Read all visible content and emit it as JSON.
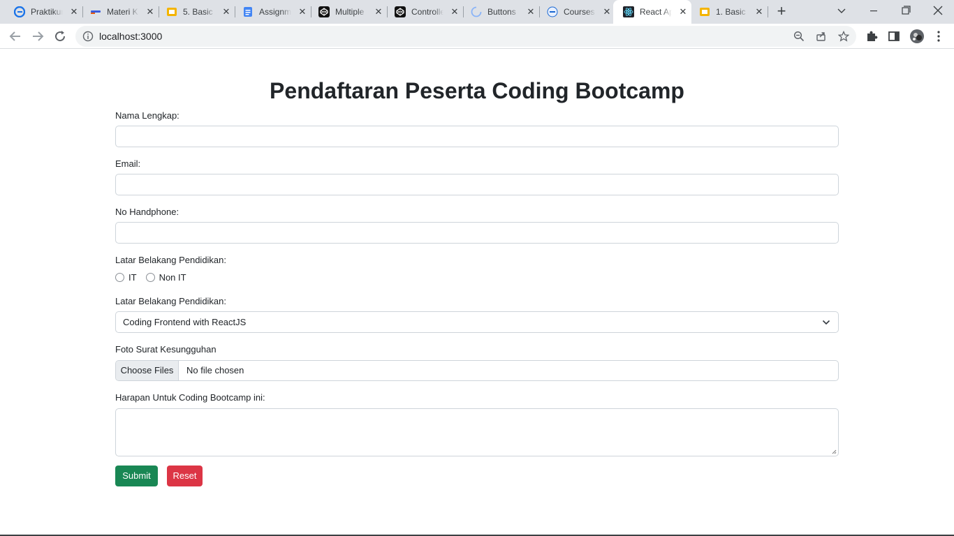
{
  "browser": {
    "tabs": [
      {
        "title": "Praktikum",
        "icon": "edge-e-icon"
      },
      {
        "title": "Materi K",
        "icon": "pen-icon"
      },
      {
        "title": "5. Basic",
        "icon": "slides-icon"
      },
      {
        "title": "Assignm",
        "icon": "docs-icon"
      },
      {
        "title": "Multiple",
        "icon": "codepen-icon"
      },
      {
        "title": "Controlle",
        "icon": "codepen-icon"
      },
      {
        "title": "Buttons",
        "icon": "loading-spinner-icon"
      },
      {
        "title": "Courses",
        "icon": "course-icon"
      },
      {
        "title": "React Ap",
        "icon": "react-icon",
        "active": true
      },
      {
        "title": "1. Basic",
        "icon": "slides-icon"
      }
    ],
    "url": "localhost:3000"
  },
  "form": {
    "title": "Pendaftaran Peserta Coding Bootcamp",
    "name_label": "Nama Lengkap:",
    "email_label": "Email:",
    "phone_label": "No Handphone:",
    "education_label": "Latar Belakang Pendidikan:",
    "radio_options": [
      "IT",
      "Non IT"
    ],
    "class_label": "Latar Belakang Pendidikan:",
    "class_selected": "Coding Frontend with ReactJS",
    "file_label": "Foto Surat Kesungguhan",
    "file_button": "Choose Files",
    "file_status": "No file chosen",
    "hope_label": "Harapan Untuk Coding Bootcamp ini:",
    "submit_label": "Submit",
    "reset_label": "Reset"
  },
  "colors": {
    "submit": "#198754",
    "reset": "#dc3545",
    "border": "#ced4da",
    "tabstrip": "#dee1e6"
  }
}
